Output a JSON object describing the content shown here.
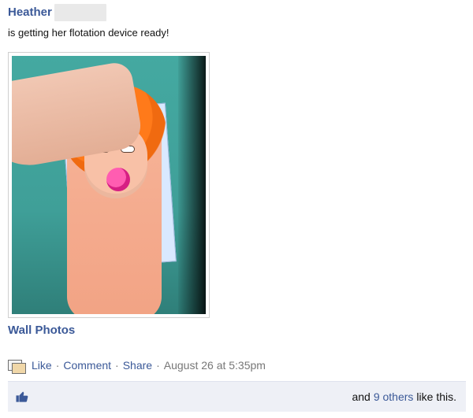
{
  "post": {
    "author": "Heather",
    "status": "is getting her flotation device ready!"
  },
  "photo": {
    "album_link": "Wall Photos"
  },
  "actions": {
    "like": "Like",
    "comment": "Comment",
    "share": "Share",
    "separator": "·",
    "timestamp": "August 26 at 5:35pm"
  },
  "likes": {
    "prefix": "and",
    "others_link": "9 others",
    "suffix": "like this."
  },
  "colors": {
    "link_blue": "#3b5998",
    "likes_bg": "#eef0f6"
  },
  "icons": {
    "photo_icon": "photo-icon",
    "thumbs_up_icon": "thumbs-up-icon"
  }
}
